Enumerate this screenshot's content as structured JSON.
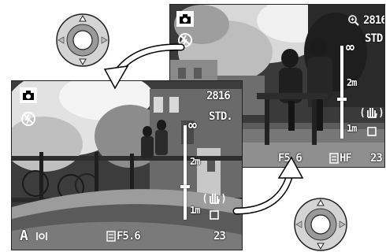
{
  "back_screen": {
    "image_size": "2816",
    "quality": "STD.",
    "focus_infinity": "∞",
    "focus_2m": "2m",
    "focus_1m": "1m",
    "aperture": "F5.6",
    "focus_mode": "HF",
    "frames_remaining": "23",
    "icons": [
      "camera-mode-icon",
      "flash-cancel-icon",
      "zoom-magnifier-icon",
      "image-stabilizer-icon",
      "single-frame-drive-icon",
      "macro-mf-icon"
    ]
  },
  "front_screen": {
    "image_size": "2816",
    "quality": "STD.",
    "focus_infinity": "∞",
    "focus_2m": "2m",
    "focus_1m": "1m",
    "exposure_mode": "A",
    "aperture": "F5.6",
    "frames_remaining": "23",
    "icons": [
      "camera-mode-icon",
      "flash-cancel-icon",
      "metering-icon",
      "image-stabilizer-icon",
      "single-frame-drive-icon",
      "aperture-select-icon"
    ]
  },
  "controllers": [
    {
      "name": "top-left-controller",
      "press": "up-down"
    },
    {
      "name": "bottom-right-controller",
      "press": "up-down"
    }
  ],
  "colors": {
    "screen_dark": "#3c3c3c",
    "overlay_text": "#ffffff",
    "arrow_fill": "#ffffff",
    "arrow_outline": "#000000",
    "pad_outer": "#d4d4d4",
    "pad_ring": "#9a9a9a"
  }
}
